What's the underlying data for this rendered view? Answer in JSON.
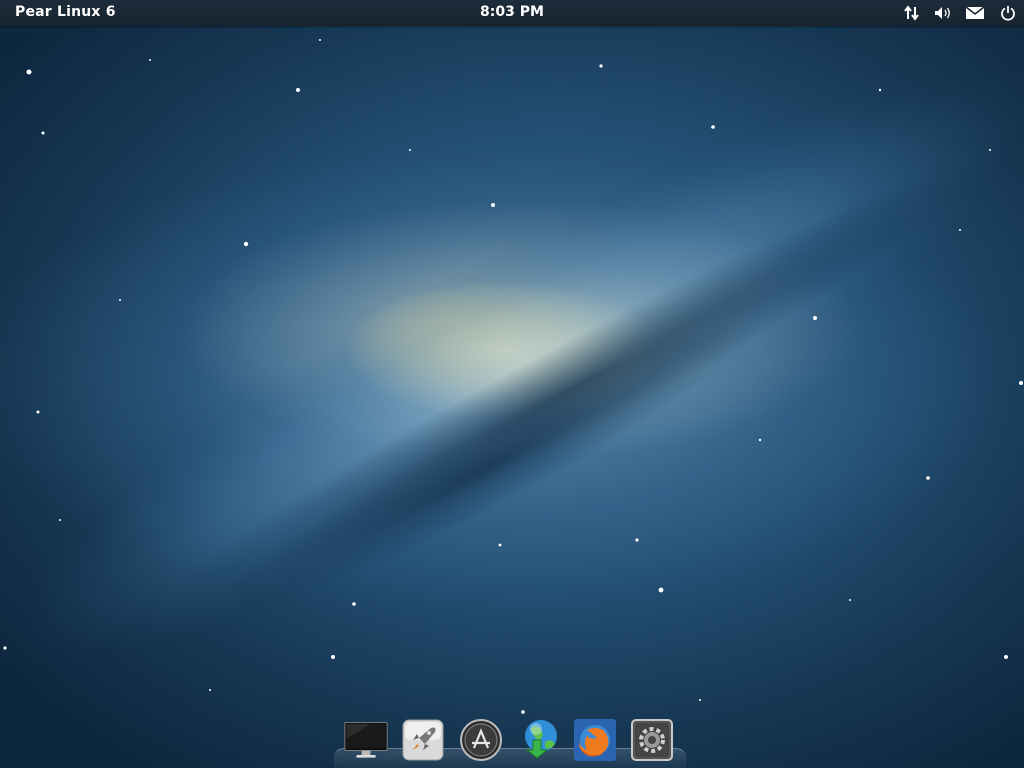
{
  "topbar": {
    "os_title": "Pear Linux 6",
    "clock": "8:03 PM",
    "tray": [
      {
        "icon": "network-arrows-icon"
      },
      {
        "icon": "volume-icon"
      },
      {
        "icon": "mail-icon"
      },
      {
        "icon": "power-icon"
      }
    ]
  },
  "wallpaper": {
    "description_icon": "galaxy-wallpaper",
    "colors": {
      "space": "#163753",
      "core": "#f6e7b5",
      "arm": "#5d8fb6"
    }
  },
  "dock": {
    "items": [
      {
        "icon": "display-icon"
      },
      {
        "icon": "launchpad-rocket-icon"
      },
      {
        "icon": "app-store-icon"
      },
      {
        "icon": "software-update-globe-icon"
      },
      {
        "icon": "firefox-icon"
      },
      {
        "icon": "system-settings-icon"
      }
    ]
  }
}
